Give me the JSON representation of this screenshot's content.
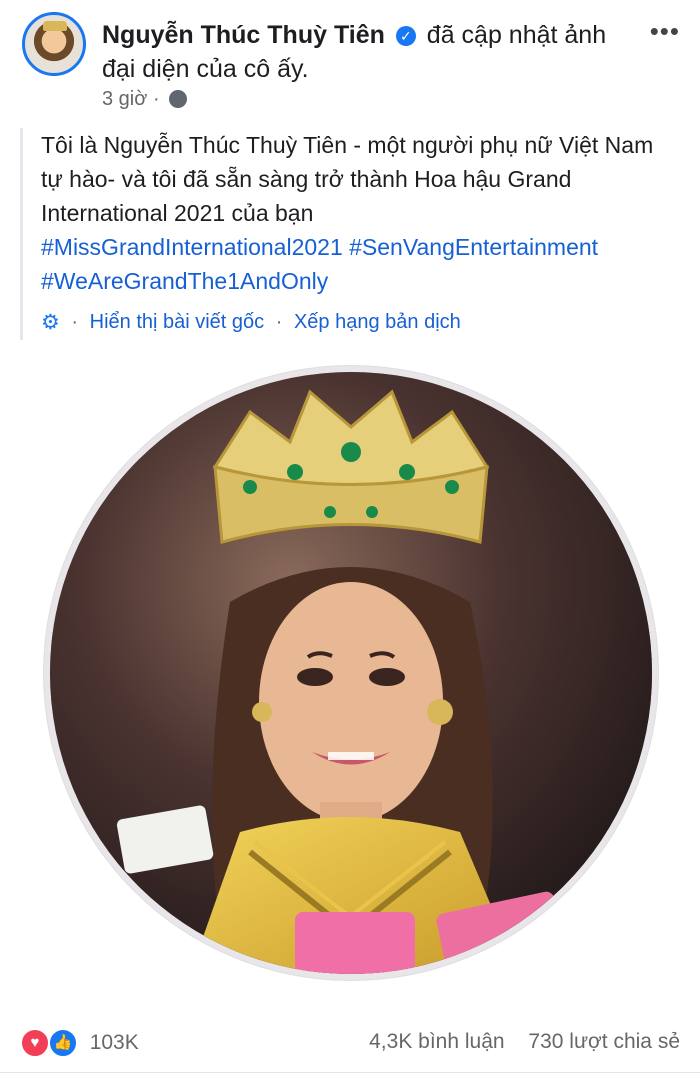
{
  "post": {
    "author": "Nguyễn Thúc Thuỳ Tiên",
    "action": "đã cập nhật ảnh đại diện của cô ấy.",
    "time": "3 giờ",
    "more_label": "•••",
    "body": "Tôi là Nguyễn Thúc Thuỳ Tiên - một người phụ nữ Việt Nam tự hào- và tôi đã sẵn sàng trở thành Hoa hậu Grand International 2021 của bạn",
    "hashtags": "#MissGrandInternational2021 #SenVangEntertainment #WeAreGrandThe1AndOnly",
    "translation": {
      "show_original": "Hiển thị bài viết gốc",
      "rate_translation": "Xếp hạng bản dịch",
      "separator": "·"
    }
  },
  "footer": {
    "reactions_count": "103K",
    "comments": "4,3K bình luận",
    "shares": "730 lượt chia sẻ"
  },
  "icons": {
    "verified": "verified-badge-icon",
    "globe": "globe-icon",
    "gear": "gear-icon",
    "love": "love-reaction-icon",
    "like": "like-reaction-icon"
  },
  "colors": {
    "link": "#1660d4",
    "accent": "#1877f2",
    "love": "#f33e58"
  }
}
